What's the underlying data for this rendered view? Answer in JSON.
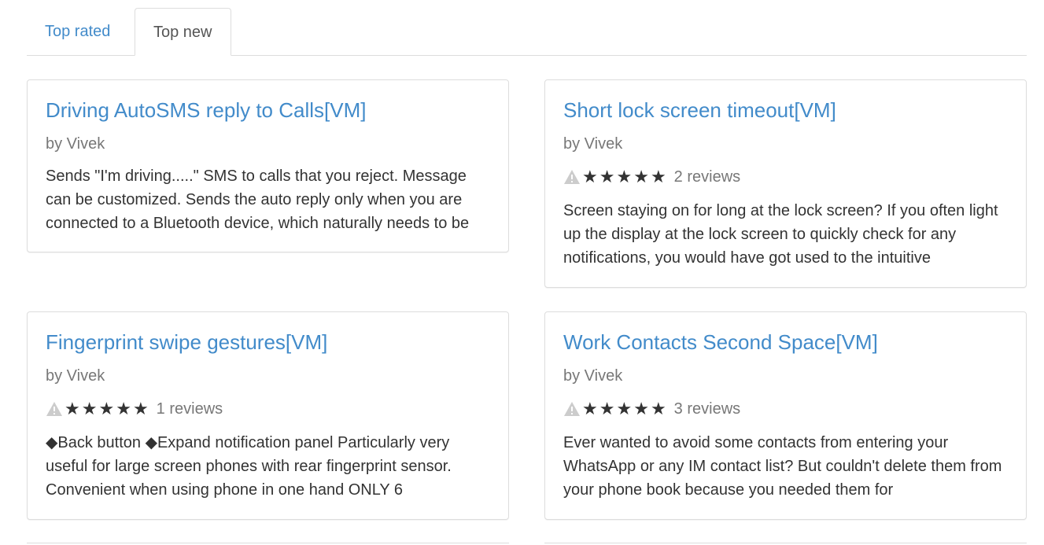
{
  "tabs": [
    {
      "label": "Top rated",
      "active": false
    },
    {
      "label": "Top new",
      "active": true
    }
  ],
  "cards": [
    {
      "title": "Driving AutoSMS reply to Calls[VM]",
      "author": "by Vivek",
      "rating": null,
      "description": "Sends \"I'm driving.....\" SMS to calls that you reject. Message can be customized. Sends the auto reply only when you are connected to a Bluetooth device, which naturally needs to be"
    },
    {
      "title": "Short lock screen timeout[VM]",
      "author": "by Vivek",
      "rating": {
        "stars": 5,
        "reviews": "2 reviews"
      },
      "description": "Screen staying on for long at the lock screen? If you often light up the display at the lock screen to quickly check for any notifications, you would have got used to the intuitive"
    },
    {
      "title": "Fingerprint swipe gestures[VM]",
      "author": "by Vivek",
      "rating": {
        "stars": 5,
        "reviews": "1 reviews"
      },
      "description": "◆Back button ◆Expand notification panel Particularly very useful for large screen phones with rear fingerprint sensor. Convenient when using phone in one hand ONLY 6"
    },
    {
      "title": "Work Contacts Second Space[VM]",
      "author": "by Vivek",
      "rating": {
        "stars": 5,
        "reviews": "3 reviews"
      },
      "description": "Ever wanted to avoid some contacts from entering your WhatsApp or any IM contact list? But couldn't delete them from your phone book because you needed them for"
    }
  ],
  "icons": {
    "warning": "warning-triangle-icon",
    "star": "star-icon"
  },
  "colors": {
    "link": "#428bca",
    "muted": "#777777",
    "text": "#333333",
    "border": "#dddddd"
  }
}
